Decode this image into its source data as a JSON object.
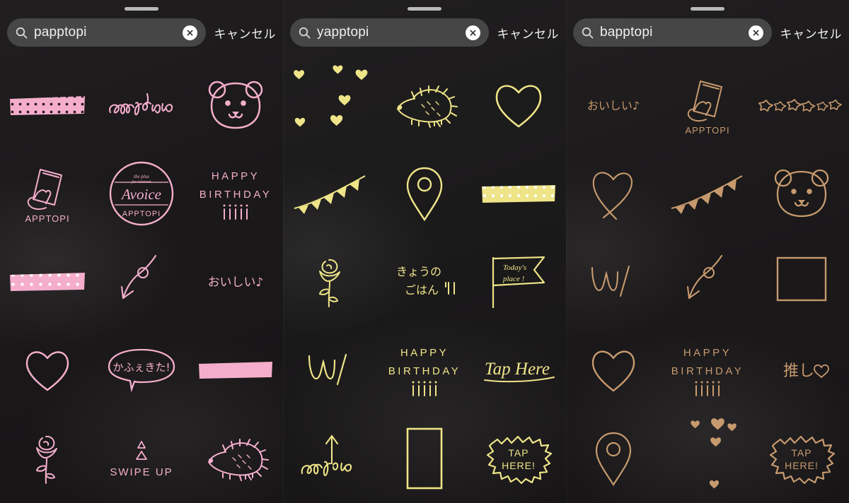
{
  "app": {
    "type": "sticker-search-picker",
    "background": "#1b1a1a",
    "comparison_panels": 3
  },
  "colors": {
    "pink": "#f4aecb",
    "yellow": "#efe588",
    "tan": "#c79a6e",
    "search_field": "#464646",
    "text": "#efefef",
    "handle": "#b9b9b9"
  },
  "panels": [
    {
      "id": "panel-pink",
      "accent": "#f4aecb",
      "search": {
        "value": "papptopi",
        "placeholder": "検索",
        "cancel_label": "キャンセル",
        "search_icon": "search-icon",
        "clear_icon": "clear-icon"
      },
      "stickers": [
        {
          "name": "washi-tape-dotted",
          "label": ""
        },
        {
          "name": "swipe-up-script",
          "label": "Swipe up"
        },
        {
          "name": "bear-face",
          "label": ""
        },
        {
          "name": "phone-hand-apptopi",
          "label": "APPTOPI"
        },
        {
          "name": "round-stamp-apptopi",
          "label": "APPTOPI"
        },
        {
          "name": "happy-birthday-candles",
          "label": "HAPPY BIRTHDAY"
        },
        {
          "name": "washi-tape-polka",
          "label": ""
        },
        {
          "name": "curved-arrow-loop",
          "label": ""
        },
        {
          "name": "oishii-text",
          "label": "おいしい"
        },
        {
          "name": "heart-outline",
          "label": ""
        },
        {
          "name": "speech-bubble-japanese",
          "label": "かふぇきた!"
        },
        {
          "name": "solid-tape",
          "label": ""
        },
        {
          "name": "rose-flower",
          "label": ""
        },
        {
          "name": "swipe-up-triangles",
          "label": "SWIPE UP"
        },
        {
          "name": "hedgehog",
          "label": ""
        }
      ]
    },
    {
      "id": "panel-yellow",
      "accent": "#efe588",
      "search": {
        "value": "yapptopi",
        "placeholder": "検索",
        "cancel_label": "キャンセル",
        "search_icon": "search-icon",
        "clear_icon": "clear-icon"
      },
      "stickers": [
        {
          "name": "scattered-hearts",
          "label": ""
        },
        {
          "name": "hedgehog",
          "label": ""
        },
        {
          "name": "heart-outline",
          "label": ""
        },
        {
          "name": "bunting-flags",
          "label": ""
        },
        {
          "name": "location-pin",
          "label": ""
        },
        {
          "name": "washi-tape-dotted",
          "label": ""
        },
        {
          "name": "rose-flower",
          "label": ""
        },
        {
          "name": "kyou-no-gohan-text",
          "label": "きょうの ごはん"
        },
        {
          "name": "todays-place-flag",
          "label": "Today's place!"
        },
        {
          "name": "w-slash-mark",
          "label": "W/"
        },
        {
          "name": "happy-birthday-candles",
          "label": "HAPPY BIRTHDAY"
        },
        {
          "name": "tap-here-script",
          "label": "Tap Here"
        },
        {
          "name": "swipe-up-arrow",
          "label": "Swipe up"
        },
        {
          "name": "rectangle-frame",
          "label": ""
        },
        {
          "name": "tap-here-starburst",
          "label": "TAP HERE!"
        }
      ]
    },
    {
      "id": "panel-tan",
      "accent": "#c79a6e",
      "search": {
        "value": "bapptopi",
        "placeholder": "検索",
        "cancel_label": "キャンセル",
        "search_icon": "search-icon",
        "clear_icon": "clear-icon"
      },
      "stickers": [
        {
          "name": "oishii-text",
          "label": "おいしい"
        },
        {
          "name": "phone-hand-apptopi",
          "label": "APPTOPI"
        },
        {
          "name": "flower-row",
          "label": ""
        },
        {
          "name": "heart-loop-outline",
          "label": ""
        },
        {
          "name": "bunting-flags",
          "label": ""
        },
        {
          "name": "bear-face",
          "label": ""
        },
        {
          "name": "w-slash-mark",
          "label": "W/"
        },
        {
          "name": "curved-arrow-loop",
          "label": ""
        },
        {
          "name": "square-frame",
          "label": ""
        },
        {
          "name": "heart-outline",
          "label": ""
        },
        {
          "name": "happy-birthday-candles",
          "label": "HAPPY BIRTHDAY"
        },
        {
          "name": "oshi-heart-text",
          "label": "推し♡"
        },
        {
          "name": "location-pin",
          "label": ""
        },
        {
          "name": "scattered-hearts",
          "label": ""
        },
        {
          "name": "tap-here-starburst",
          "label": "TAP HERE!"
        }
      ]
    }
  ]
}
